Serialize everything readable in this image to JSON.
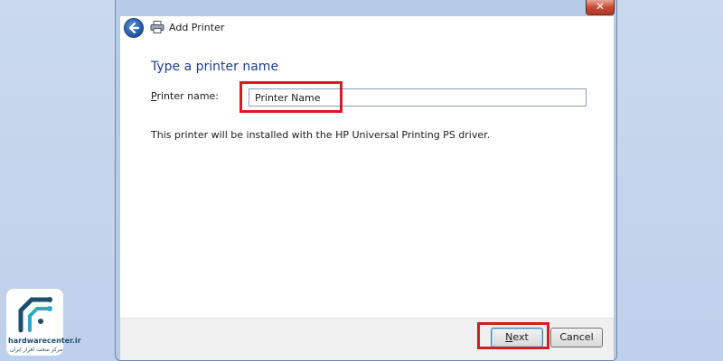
{
  "window": {
    "title": "Add Printer",
    "close_symbol": "✕",
    "back_icon": "back-arrow-icon",
    "printer_icon": "printer-icon"
  },
  "main": {
    "heading": "Type a printer name",
    "field_label_accel": "P",
    "field_label_rest": "rinter name:",
    "printer_name_value": "Printer Name",
    "driver_info": "This printer will be installed with the HP Universal Printing PS driver."
  },
  "footer": {
    "next_label_accel": "N",
    "next_label_rest": "ext",
    "cancel_label": "Cancel"
  },
  "watermark": {
    "site": "hardwarecenter.ir",
    "tagline": "مرکز سخت افزار ایران"
  },
  "colors": {
    "highlight": "#d41c24",
    "heading": "#1e3d8f"
  }
}
